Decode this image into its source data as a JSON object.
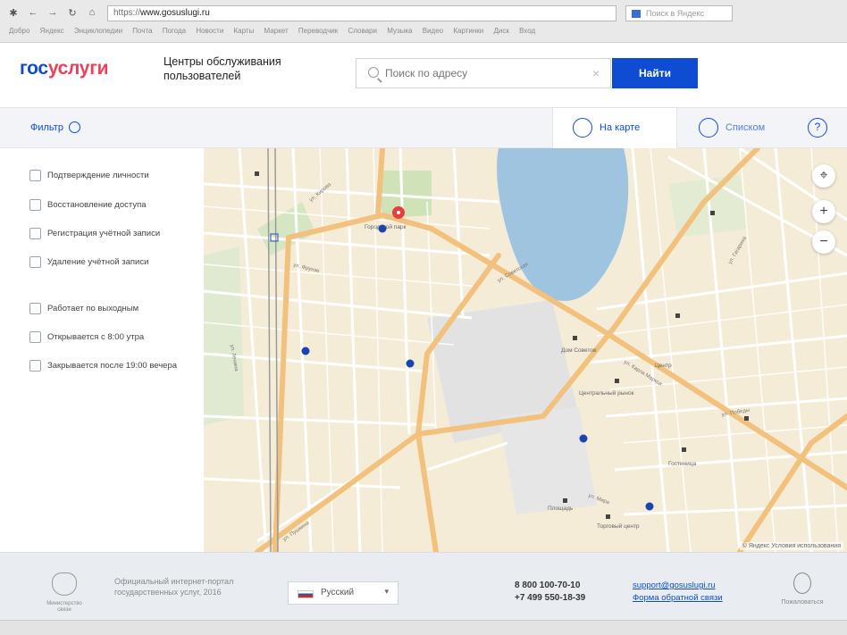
{
  "browser": {
    "nav_buttons": [
      "✱",
      "←",
      "→",
      "↻",
      "⌂"
    ],
    "address": "www.gosuslugi.ru",
    "address_prefix": "https://",
    "search_placeholder": "Поиск в Яндекс",
    "bookmarks": [
      "Добро",
      "Яндекс",
      "Энциклопедии",
      "Почта",
      "Погода",
      "Новости",
      "Карты",
      "Маркет",
      "Переводчик",
      "Словари",
      "Музыка",
      "Видео",
      "Картинки",
      "Диск",
      "Вход"
    ]
  },
  "header": {
    "logo_part1": "гос",
    "logo_part2": "услуги",
    "subtitle": "Центры обслуживания пользователей",
    "search_placeholder": "Поиск по адресу",
    "search_button": "Найти"
  },
  "toolbar": {
    "filter_label": "Фильтр",
    "tab_map": "На карте",
    "tab_list": "Списком",
    "help": "?"
  },
  "filters": [
    "Подтверждение личности",
    "Восстановление доступа",
    "Регистрация учётной записи",
    "Удаление учётной записи",
    "Работает по выходным",
    "Открывается с 8:00 утра",
    "Закрывается после 19:00 вечера"
  ],
  "map": {
    "controls": {
      "locate": "⌖",
      "zoom_in": "+",
      "zoom_out": "−"
    },
    "attribution": "© Яндекс  Условия использования",
    "streets": [
      "ул. Фрунзе",
      "ул. Советская",
      "ул. Пушкина",
      "ул. Карла Маркса",
      "ул. Ленина",
      "ул. Гагарина",
      "ул. Кирова",
      "ул. Победы",
      "ул. Мира"
    ],
    "places": [
      "Центр",
      "Дом Советов",
      "Центральный рынок",
      "Городской парк",
      "Площадь",
      "Торговый центр",
      "Гостиница"
    ],
    "colors": {
      "land": "#f4ecd7",
      "water": "#9fc4e0",
      "park": "#cfe2b8",
      "road": "#ffffff",
      "major_road": "#f2c17d",
      "marker": "#1a45b0",
      "selected": "#e53e3e"
    }
  },
  "footer": {
    "emblem_caption": "Министерство связи",
    "description": "Официальный интернет-портал государственных услуг, 2016",
    "language": "Русский",
    "phone1": "8 800 100-70-10",
    "phone2": "+7 499 550-18-39",
    "email": "support@gosuslugi.ru",
    "feedback_form": "Форма обратной связи",
    "feedback_caption": "Пожаловаться"
  }
}
